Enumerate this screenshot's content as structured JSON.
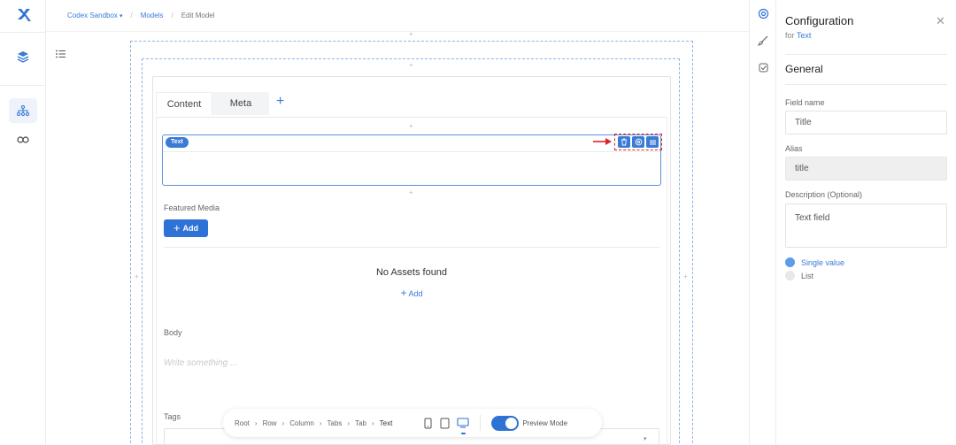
{
  "breadcrumb": {
    "workspace": "Codex Sandbox",
    "section": "Models",
    "current": "Edit Model"
  },
  "canvas": {
    "tabs": [
      {
        "label": "Content",
        "active": true
      },
      {
        "label": "Meta",
        "active": false
      }
    ],
    "text_chip": "Text",
    "featured_media_label": "Featured Media",
    "add_button_label": "Add",
    "no_assets_text": "No Assets found",
    "add_link_label": "Add",
    "body_label": "Body",
    "body_placeholder": "Write something ...",
    "tags_label": "Tags"
  },
  "bottombar": {
    "path": [
      "Root",
      "Row",
      "Column",
      "Tabs",
      "Tab",
      "Text"
    ],
    "preview_label": "Preview Mode",
    "preview_on": true
  },
  "config": {
    "title": "Configuration",
    "for_prefix": "for",
    "for_target": "Text",
    "section": "General",
    "field_name_label": "Field name",
    "field_name_value": "Title",
    "alias_label": "Alias",
    "alias_value": "title",
    "description_label": "Description (Optional)",
    "description_value": "Text field",
    "options": [
      {
        "label": "Single value",
        "selected": true
      },
      {
        "label": "List",
        "selected": false
      }
    ]
  },
  "colors": {
    "accent": "#2f72d6",
    "highlight": "#d9232d"
  }
}
